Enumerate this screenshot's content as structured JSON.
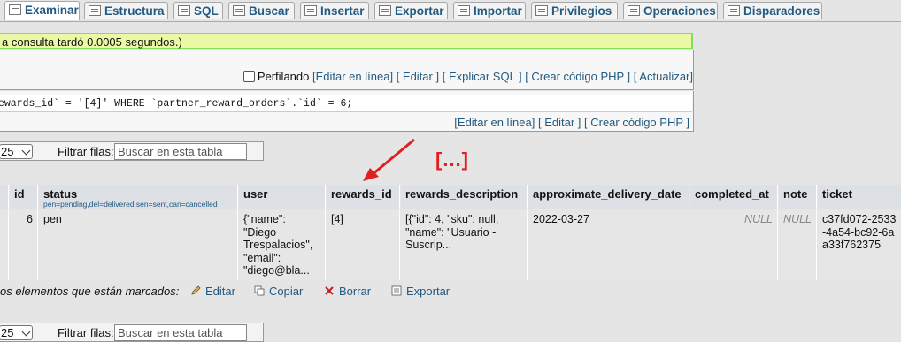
{
  "tabs": [
    {
      "label": "Examinar",
      "icon": "browse-icon",
      "active": true
    },
    {
      "label": "Estructura",
      "icon": "structure-icon"
    },
    {
      "label": "SQL",
      "icon": "sql-icon"
    },
    {
      "label": "Buscar",
      "icon": "search-icon"
    },
    {
      "label": "Insertar",
      "icon": "insert-icon"
    },
    {
      "label": "Exportar",
      "icon": "export-icon"
    },
    {
      "label": "Importar",
      "icon": "import-icon"
    },
    {
      "label": "Privilegios",
      "icon": "privileges-icon"
    },
    {
      "label": "Operaciones",
      "icon": "operations-icon"
    },
    {
      "label": "Disparadores",
      "icon": "triggers-icon"
    }
  ],
  "status": {
    "success_message": "a consulta tardó 0.0005 segundos.)"
  },
  "query_box": {
    "profiling_label": "Perfilando",
    "links": [
      "[Editar en línea]",
      "[ Editar ]",
      "[ Explicar SQL ]",
      "[ Crear código PHP ]",
      "[ Actualizar]"
    ]
  },
  "sql": {
    "text": "ewards_id` = '[4]' WHERE `partner_reward_orders`.`id` = 6;",
    "links": [
      "[Editar en línea]",
      "[ Editar ]",
      "[ Crear código PHP ]"
    ]
  },
  "filter": {
    "rows_value": "25",
    "label": "Filtrar filas:",
    "placeholder": "Buscar en esta tabla"
  },
  "annotation": {
    "ellipsis": "[...]",
    "arrow_color": "#e02020"
  },
  "table": {
    "columns": [
      {
        "name": "id"
      },
      {
        "name": "status",
        "legend": "pen=pending,del=delivered,sen=sent,can=cancelled"
      },
      {
        "name": "user"
      },
      {
        "name": "rewards_id"
      },
      {
        "name": "rewards_description"
      },
      {
        "name": "approximate_delivery_date"
      },
      {
        "name": "completed_at"
      },
      {
        "name": "note"
      },
      {
        "name": "ticket"
      }
    ],
    "rows": [
      {
        "id": "6",
        "status": "pen",
        "user": "{\"name\": \"Diego Trespalacios\", \"email\": \"diego@bla...",
        "rewards_id": "[4]",
        "rewards_description": "[{\"id\": 4, \"sku\": null, \"name\": \"Usuario - Suscrip...",
        "approximate_delivery_date": "2022-03-27",
        "completed_at": "NULL",
        "note": "NULL",
        "ticket": "c37fd072-2533-4a54-bc92-6aa33f762375"
      }
    ]
  },
  "bulk_actions": {
    "label": "os elementos que están marcados:",
    "edit": "Editar",
    "copy": "Copiar",
    "delete": "Borrar",
    "export": "Exportar"
  }
}
